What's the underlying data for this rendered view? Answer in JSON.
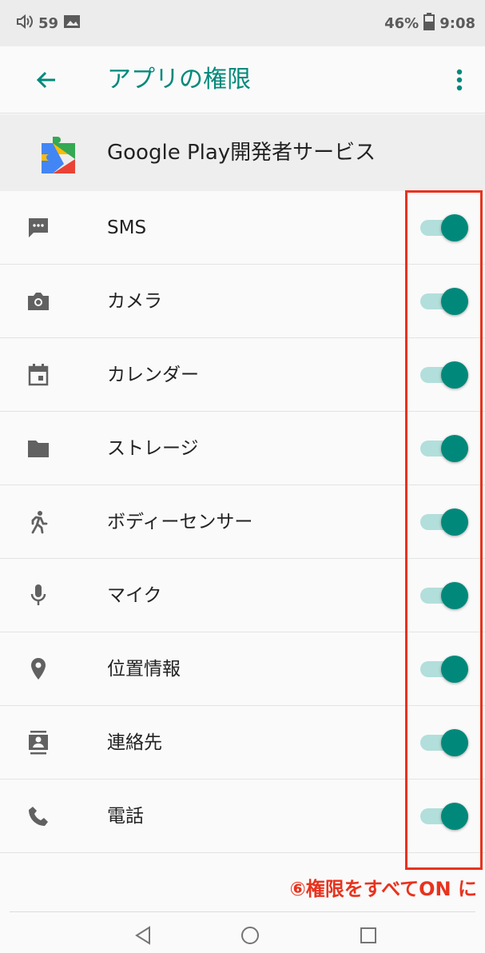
{
  "status_bar": {
    "volume": "59",
    "battery": "46%",
    "time": "9:08"
  },
  "app_bar": {
    "title": "アプリの権限"
  },
  "app": {
    "name": "Google Play開発者サービス"
  },
  "permissions": [
    {
      "icon": "sms-icon",
      "label": "SMS",
      "enabled": true
    },
    {
      "icon": "camera-icon",
      "label": "カメラ",
      "enabled": true
    },
    {
      "icon": "calendar-icon",
      "label": "カレンダー",
      "enabled": true
    },
    {
      "icon": "folder-icon",
      "label": "ストレージ",
      "enabled": true
    },
    {
      "icon": "walking-person-icon",
      "label": "ボディーセンサー",
      "enabled": true
    },
    {
      "icon": "microphone-icon",
      "label": "マイク",
      "enabled": true
    },
    {
      "icon": "location-pin-icon",
      "label": "位置情報",
      "enabled": true
    },
    {
      "icon": "contacts-icon",
      "label": "連絡先",
      "enabled": true
    },
    {
      "icon": "phone-icon",
      "label": "電話",
      "enabled": true
    }
  ],
  "annotation": {
    "text": "⑥権限をすべてON に"
  },
  "colors": {
    "accent": "#00897b",
    "track": "#b2dfdb",
    "annotation": "#e8331e"
  }
}
